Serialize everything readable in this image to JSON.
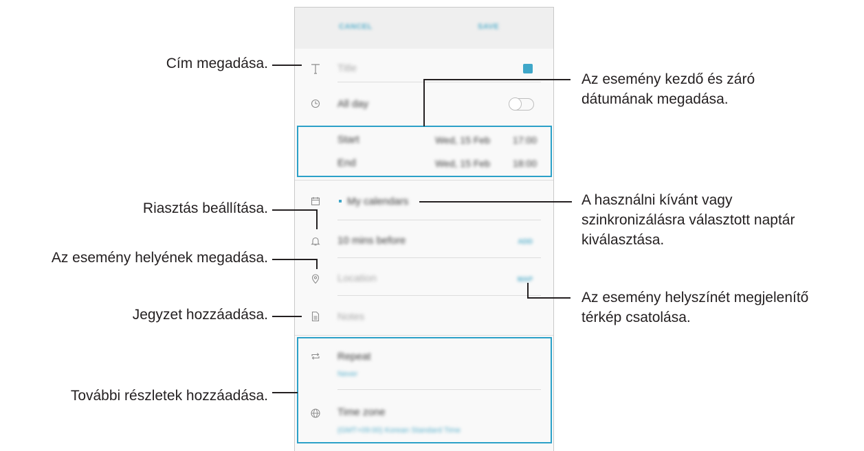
{
  "app": {
    "cancel": "CANCEL",
    "save": "SAVE"
  },
  "form": {
    "title_placeholder": "Title",
    "color": "#3fa7c9",
    "all_day_label": "All day",
    "all_day_on": false,
    "start_label": "Start",
    "start_date": "Wed, 15 Feb",
    "start_time": "17:00",
    "end_label": "End",
    "end_date": "Wed, 15 Feb",
    "end_time": "18:00",
    "calendar": "My calendars",
    "reminder": "10 mins before",
    "reminder_action": "ADD",
    "location_placeholder": "Location",
    "location_action": "MAP",
    "notes_placeholder": "Notes",
    "repeat_label": "Repeat",
    "repeat_value": "Never",
    "timezone_label": "Time zone",
    "timezone_value": "(GMT+09:00) Korean Standard Time"
  },
  "icons": {
    "title": "text-t-icon",
    "all_day": "clock-icon",
    "calendar": "calendar-icon",
    "reminder": "bell-icon",
    "location": "location-pin-icon",
    "notes": "document-icon",
    "repeat": "repeat-icon",
    "timezone": "globe-icon"
  },
  "annotations": {
    "title": "Cím megadása.",
    "dates_line1": "Az esemény kezdő és záró",
    "dates_line2": "dátumának megadása.",
    "alarm": "Riasztás beállítása.",
    "calendar_line1": "A használni kívánt vagy",
    "calendar_line2": "szinkronizálásra választott naptár",
    "calendar_line3": "kiválasztása.",
    "location": "Az esemény helyének megadása.",
    "map_line1": "Az esemény helyszínét megjelenítő",
    "map_line2": "térkép csatolása.",
    "notes": "Jegyzet hozzáadása.",
    "details": "További részletek hozzáadása."
  },
  "colors": {
    "accent": "#3fa7c9",
    "highlight_box": "#2aa0c8",
    "callout_line": "#231f20"
  }
}
